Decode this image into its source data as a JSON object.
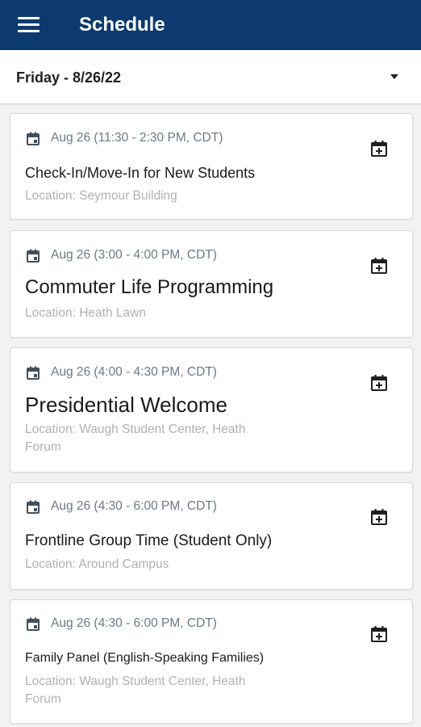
{
  "header": {
    "title": "Schedule",
    "menu_icon": "hamburger-menu-icon"
  },
  "date_selector": {
    "selected": "Friday - 8/26/22",
    "icon": "dropdown-arrow-icon"
  },
  "colors": {
    "header_bg": "#0d3a6e",
    "time_text": "#6c7986",
    "location_text": "#b1b1b1"
  },
  "events": [
    {
      "time": "Aug 26 (11:30 - 2:30 PM, CDT)",
      "title": "Check-In/Move-In for New Students",
      "location": "Location: Seymour Building"
    },
    {
      "time": "Aug 26 (3:00 - 4:00 PM, CDT)",
      "title": "Commuter Life Programming",
      "location": "Location: Heath Lawn"
    },
    {
      "time": "Aug 26 (4:00 - 4:30 PM, CDT)",
      "title": "Presidential Welcome",
      "location": "Location: Waugh Student Center, Heath Forum"
    },
    {
      "time": "Aug 26 (4:30 - 6:00 PM, CDT)",
      "title": "Frontline Group Time (Student Only)",
      "location": "Location: Around Campus"
    },
    {
      "time": "Aug 26 (4:30 - 6:00 PM, CDT)",
      "title": "Family Panel (English-Speaking Families)",
      "location": "Location: Waugh Student Center, Heath Forum"
    }
  ]
}
